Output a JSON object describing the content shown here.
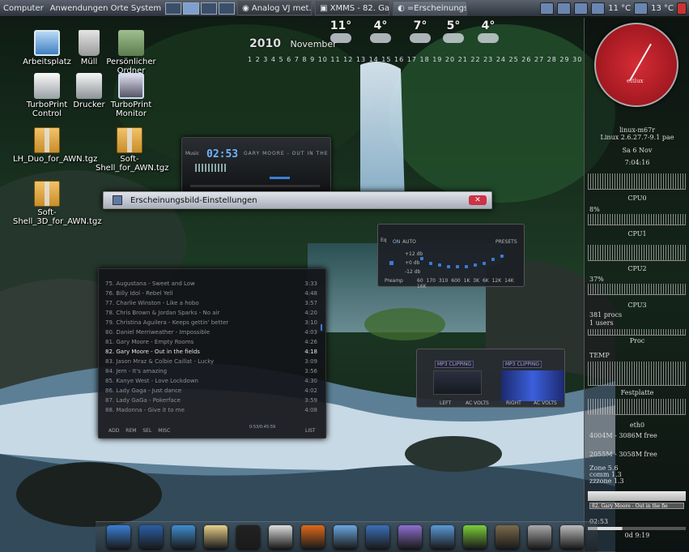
{
  "top_panel": {
    "menu_apps": "Computer",
    "menu_places": "Anwendungen Orte System",
    "tasks": [
      "Analog VJ met...",
      "XMMS - 82. Ga...",
      "=Erscheinungs..."
    ],
    "clock_text": "11 °C",
    "temp_text": "13 °C"
  },
  "desktop_icons": [
    {
      "label": "Arbeitsplatz",
      "icon": "computer-icon"
    },
    {
      "label": "Müll",
      "icon": "trash-icon"
    },
    {
      "label": "Persönlicher Ordner",
      "icon": "home-folder-icon"
    },
    {
      "label": "TurboPrint Control",
      "icon": "printer-icon"
    },
    {
      "label": "Drucker",
      "icon": "printer-icon"
    },
    {
      "label": "TurboPrint Monitor",
      "icon": "monitor-icon"
    },
    {
      "label": "LH_Duo_for_AWN.tgz",
      "icon": "package-icon"
    },
    {
      "label": "Soft-Shell_for_AWN.tgz",
      "icon": "package-icon"
    },
    {
      "label": "Soft-Shell_3D_for_AWN.tgz",
      "icon": "package-icon"
    }
  ],
  "calendar": {
    "year": "2010",
    "month": "November",
    "days": "1 2 3 4 5 6 7 8 9 10 11 12 13 14 15 16 17 18 19 20 21 22 23 24 25 26 27 28 29 30"
  },
  "weather": [
    {
      "temp": "11°"
    },
    {
      "temp": "4°"
    },
    {
      "temp": "7°"
    },
    {
      "temp": "5°"
    },
    {
      "temp": "4°"
    }
  ],
  "xmms": {
    "label": "Music",
    "time": "02:53",
    "song": "GARY MOORE - OUT IN THE FIELDS"
  },
  "dialog": {
    "title": "Erscheinungsbild-Einstellungen"
  },
  "equalizer": {
    "title": "Eq",
    "on": "ON",
    "auto": "AUTO",
    "presets": "PRESETS",
    "preamp": "Preamp",
    "freqs": "60 170 310 600 1K 3K 6K 12K 14K 16K",
    "db_top": "+12 db",
    "db_mid": "+0 db",
    "db_bot": "-12 db",
    "levels": [
      0.22,
      0.45,
      0.55,
      0.6,
      0.6,
      0.6,
      0.55,
      0.45,
      0.25,
      0.1
    ]
  },
  "playlist": {
    "rows": [
      {
        "n": "75. Augustana - Sweet and Low",
        "t": "3:33"
      },
      {
        "n": "76. Billy Idol - Rebel Yell",
        "t": "4:48"
      },
      {
        "n": "77. Charlie Winston - Like a hobo",
        "t": "3:57"
      },
      {
        "n": "78. Chris Brown & Jordan Sparks - No air",
        "t": "4:20"
      },
      {
        "n": "79. Christina Aguilera - Keeps gettin' better",
        "t": "3:10"
      },
      {
        "n": "80. Daniel Merriweather - Impossible",
        "t": "4:03"
      },
      {
        "n": "81. Gary Moore - Empty Rooms",
        "t": "4:26"
      },
      {
        "n": "82. Gary Moore - Out in the fields",
        "t": "4:18"
      },
      {
        "n": "83. Jason Mraz & Colbie Caillat - Lucky",
        "t": "3:09"
      },
      {
        "n": "84. Jem - It's amazing",
        "t": "3:56"
      },
      {
        "n": "85. Kanye West - Love Lockdown",
        "t": "4:30"
      },
      {
        "n": "86. Lady Gaga - Just dance",
        "t": "4:02"
      },
      {
        "n": "87. Lady GaGa - Pokerface",
        "t": "3:59"
      },
      {
        "n": "88. Madonna - Give it to me",
        "t": "4:08"
      }
    ],
    "current_index": 7,
    "buttons": [
      "ADD",
      "REM",
      "SEL",
      "MISC"
    ],
    "list_btn": "LIST",
    "total": "0:53/0:45:59"
  },
  "plugin": {
    "left_title": "MP3 CLIPPING",
    "right_title": "MP3 CLIPPING",
    "left": "LEFT",
    "right": "RIGHT",
    "ac_left": "AC VOLTS",
    "ac_right": "AC VOLTS"
  },
  "conky": {
    "hostname": "linux-m67r",
    "kernel": "Linux 2.6.27.7-9.1 pae",
    "date": "Sa 6 Nov",
    "time": "7:04:16",
    "cpu0": "CPU0",
    "cpu0_pct": "8%",
    "cpu1": "CPU1",
    "cpu2": "CPU2",
    "cpu2_pct": "37%",
    "cpu3": "CPU3",
    "procs": "381 procs",
    "users": "1 users",
    "proc_label": "Proc",
    "temp_label": "TEMP",
    "disk_label": "Festplatte",
    "eth_label": "eth0",
    "disk1": "4004M - 3086M free",
    "disk2": "2055M - 3058M free",
    "zone": "Zone 5.6",
    "comm": "comm 1.3",
    "zzzone": "zzzone 1.3",
    "now_playing": "82. Gary Moore - Out in the fie",
    "elapsed": "02:53",
    "uptime": "0d 9:19",
    "clock_brand": "ettlux"
  },
  "dock_icons": [
    "globe-icon",
    "home-icon",
    "editor-icon",
    "notes-icon",
    "terminal-icon",
    "settings-icon",
    "firefox-icon",
    "itunes-icon",
    "network-icon",
    "paint-icon",
    "document-icon",
    "chat-icon",
    "gimp-icon",
    "music-icon",
    "trash-icon"
  ]
}
